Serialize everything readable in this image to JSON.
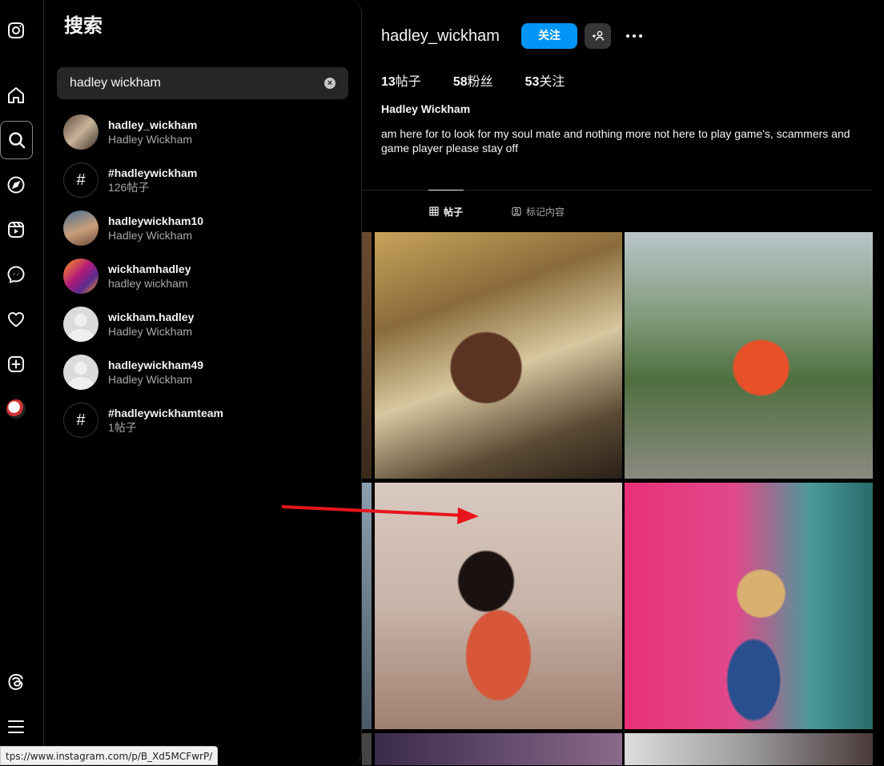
{
  "browser": {
    "status_url": "tps://www.instagram.com/p/B_Xd5MCFwrP/"
  },
  "rail": {
    "items": [
      "instagram-logo",
      "home",
      "search",
      "explore",
      "reels",
      "messages",
      "notifications",
      "create",
      "profile",
      "threads",
      "more"
    ]
  },
  "search": {
    "title": "搜索",
    "query": "hadley wickham",
    "clear_glyph": "×",
    "results": [
      {
        "name": "hadley_wickham",
        "sub": "Hadley Wickham",
        "avatar": "photo"
      },
      {
        "name": "#hadleywickham",
        "sub": "126帖子",
        "avatar": "hash"
      },
      {
        "name": "hadleywickham10",
        "sub": "Hadley Wickham",
        "avatar": "photo"
      },
      {
        "name": "wickhamhadley",
        "sub": "hadley wickham",
        "avatar": "photo"
      },
      {
        "name": "wickham.hadley",
        "sub": "Hadley Wickham",
        "avatar": "default"
      },
      {
        "name": "hadleywickham49",
        "sub": "Hadley Wickham",
        "avatar": "default"
      },
      {
        "name": "#hadleywickhamteam",
        "sub": "1帖子",
        "avatar": "hash"
      }
    ]
  },
  "profile": {
    "username": "hadley_wickham",
    "follow_label": "关注",
    "posts_count": "13",
    "posts_label": "帖子",
    "followers_count": "58",
    "followers_label": "粉丝",
    "following_count": "53",
    "following_label": "关注",
    "full_name": "Hadley Wickham",
    "bio": "am here for to look for my soul mate and nothing more not here to play game's, scammers and game player please stay off",
    "tabs": [
      {
        "label": "帖子",
        "active": true
      },
      {
        "label": "标记内容",
        "active": false
      }
    ]
  },
  "colors": {
    "accent": "#0095f6",
    "background": "#000000",
    "annotation_arrow": "#e8141c"
  }
}
